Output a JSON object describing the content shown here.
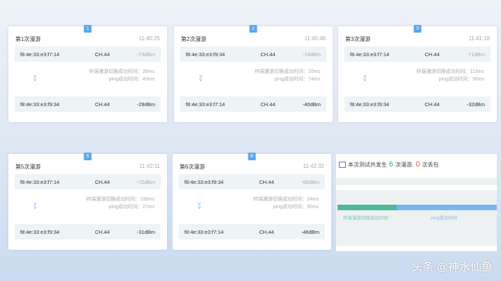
{
  "cards": [
    {
      "badge": "1",
      "title": "第1次漫游",
      "time": "11:40:25",
      "from": {
        "mac": "f8:4e:33:e3:f7:14",
        "ch": "CH.44",
        "sig": "-73dBm"
      },
      "to": {
        "mac": "f8:4e:33:e3:f9:34",
        "ch": "CH.44",
        "sig": "-29dBm"
      },
      "switch": "终端漫游切换成功时间：26ms",
      "ping": "ping成功时间：43ms"
    },
    {
      "badge": "2",
      "title": "第2次漫游",
      "time": "11:40:46",
      "from": {
        "mac": "f8:4e:33:e3:f9:34",
        "ch": "CH.44",
        "sig": "-74dBm"
      },
      "to": {
        "mac": "f8:4e:33:e3:f7:14",
        "ch": "CH.44",
        "sig": "-40dBm"
      },
      "switch": "终端漫游切换成功时间：20ms",
      "ping": "ping成功时间：74ms"
    },
    {
      "badge": "3",
      "title": "第3次漫游",
      "time": "11:41:18",
      "from": {
        "mac": "f8:4e:33:e3:f7:14",
        "ch": "CH.44",
        "sig": "-71dBm"
      },
      "to": {
        "mac": "f8:4e:33:e3:f9:34",
        "ch": "CH.44",
        "sig": "-32dBm"
      },
      "switch": "终端漫游切换成功时间：113ms",
      "ping": "ping成功时间：30ms"
    },
    {
      "badge": "5",
      "title": "第5次漫游",
      "time": "11:42:11",
      "from": {
        "mac": "f8:4e:33:e3:f7:14",
        "ch": "CH.44",
        "sig": "-72dBm"
      },
      "to": {
        "mac": "f8:4e:33:e3:f9:34",
        "ch": "CH.44",
        "sig": "-31dBm"
      },
      "switch": "终端漫游切换成功时间：108ms",
      "ping": "ping成功时间：27ms"
    },
    {
      "badge": "6",
      "title": "第6次漫游",
      "time": "11:42:32",
      "from": {
        "mac": "f8:4e:33:e3:f9:34",
        "ch": "CH.44",
        "sig": "-66dBm"
      },
      "to": {
        "mac": "f8:4e:33:e3:f7:14",
        "ch": "CH.44",
        "sig": "-46dBm"
      },
      "switch": "终端漫游切换成功时间：24ms",
      "ping": "ping成功时间：35ms"
    }
  ],
  "summary": {
    "prefix": "本次测试共发生",
    "roams": "6",
    "mid": "次漫游,",
    "loss": "0",
    "suffix": "次丢包",
    "legend1": "终端漫游切换成功时间",
    "legend2": "ping成功时间",
    "bar_fraction_green": 0.37,
    "green": "#4db89a",
    "blue": "#79b8ef"
  },
  "watermark": "头条 @神水仙鱼"
}
